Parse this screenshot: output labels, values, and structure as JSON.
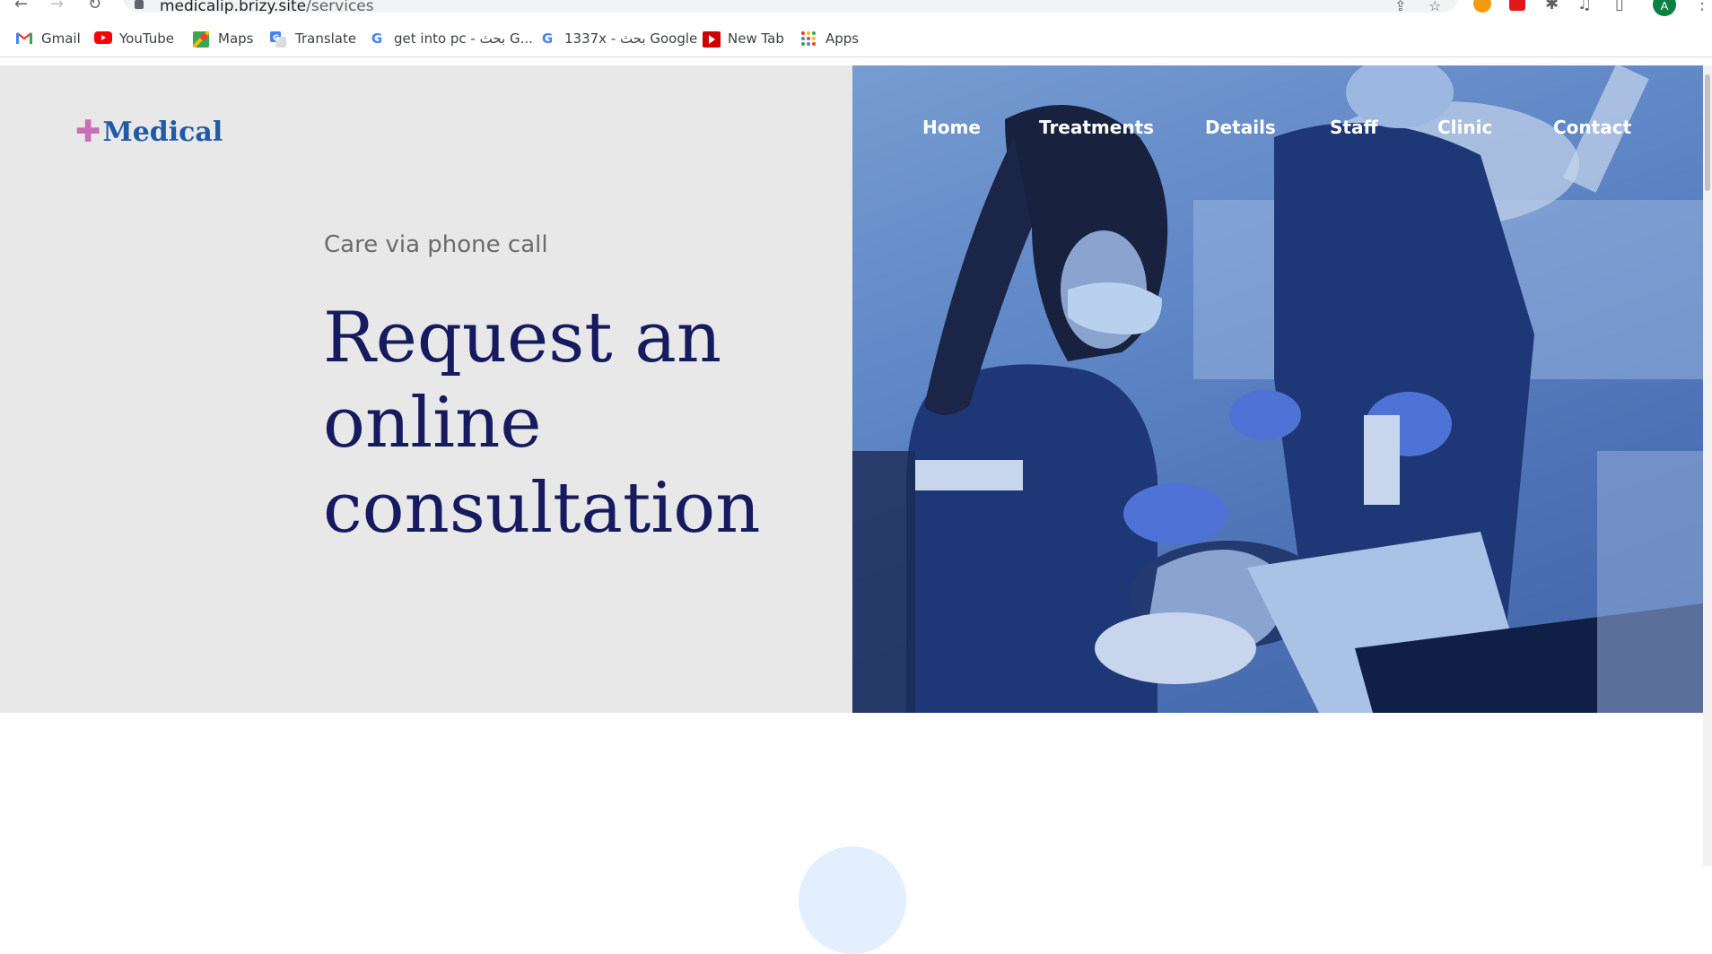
{
  "browser": {
    "url_domain": "medicalip.brizy.site",
    "url_path": "/services",
    "avatar_letter": "A"
  },
  "bookmarks": [
    {
      "label": "Gmail",
      "icon": "gmail-icon"
    },
    {
      "label": "YouTube",
      "icon": "youtube-icon"
    },
    {
      "label": "Maps",
      "icon": "maps-icon"
    },
    {
      "label": "Translate",
      "icon": "translate-icon"
    },
    {
      "label": "get into pc - بحث G...",
      "icon": "google-icon"
    },
    {
      "label": "1337x - بحث Google",
      "icon": "google-icon"
    },
    {
      "label": "New Tab",
      "icon": "newtab-icon"
    },
    {
      "label": "Apps",
      "icon": "apps-grid-icon"
    }
  ],
  "site": {
    "logo_text": "Medical",
    "logo_cross": "✚",
    "nav": [
      "Home",
      "Treatments",
      "Details",
      "Staff",
      "Clinic",
      "Contact"
    ],
    "eyebrow": "Care via phone call",
    "headline_lines": [
      "Request an",
      "online",
      "consultation"
    ]
  },
  "colors": {
    "brand_blue": "#1f59a8",
    "cross_pink": "#c770b8",
    "headline_navy": "#161a5e",
    "hero_bg": "#e8e8e8",
    "photo_tint": "#3d62a9"
  }
}
